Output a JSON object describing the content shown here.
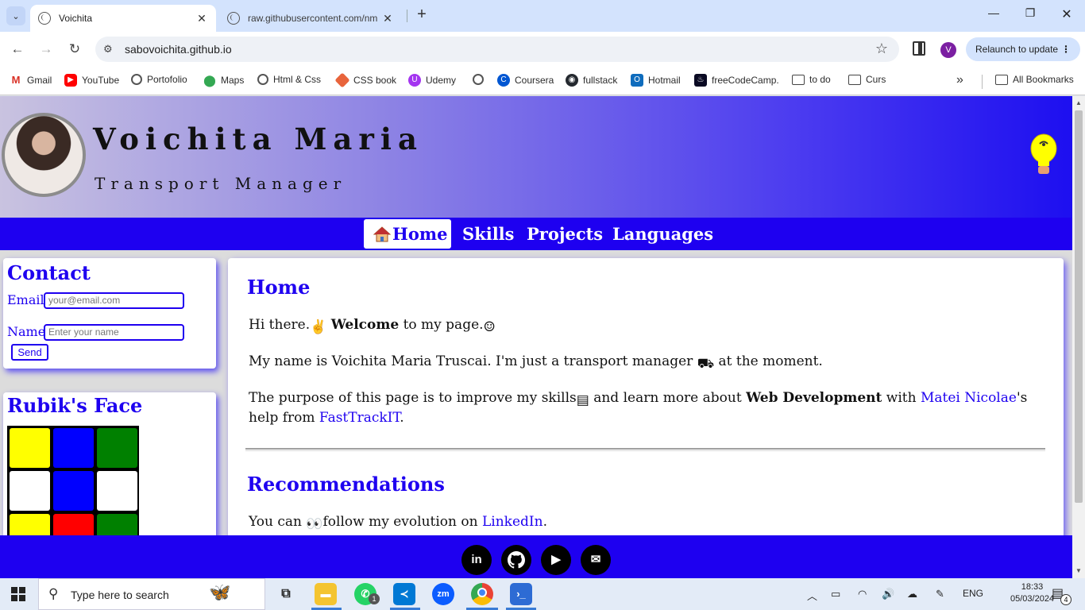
{
  "browser": {
    "tabs": [
      {
        "title": "Voichita",
        "active": true
      },
      {
        "title": "raw.githubusercontent.com/nm",
        "active": false
      }
    ],
    "url": "sabovoichita.github.io",
    "profile_initial": "V",
    "relaunch_label": "Relaunch to update",
    "bookmarks": [
      {
        "label": "Gmail",
        "icon": "gmail-icon"
      },
      {
        "label": "YouTube",
        "icon": "youtube-icon"
      },
      {
        "label": "Portofolio",
        "icon": "globe-icon"
      },
      {
        "label": "Maps",
        "icon": "maps-icon"
      },
      {
        "label": "Html & Css",
        "icon": "globe-icon"
      },
      {
        "label": "CSS book",
        "icon": "css-book-icon"
      },
      {
        "label": "Udemy",
        "icon": "udemy-icon"
      },
      {
        "label": "",
        "icon": "globe-icon"
      },
      {
        "label": "Coursera",
        "icon": "coursera-icon"
      },
      {
        "label": "fullstack",
        "icon": "github-icon"
      },
      {
        "label": "Hotmail",
        "icon": "outlook-icon"
      },
      {
        "label": "freeCodeCamp.",
        "icon": "freecodecamp-icon"
      },
      {
        "label": "to do",
        "icon": "folder-icon"
      },
      {
        "label": "Curs",
        "icon": "folder-icon"
      }
    ],
    "all_bookmarks_label": "All Bookmarks"
  },
  "page": {
    "hero": {
      "name": "Voichita Maria",
      "role": "Transport Manager"
    },
    "nav": {
      "items": [
        {
          "label": "Home",
          "active": true
        },
        {
          "label": "Skills",
          "active": false
        },
        {
          "label": "Projects",
          "active": false
        },
        {
          "label": "Languages",
          "active": false
        }
      ]
    },
    "contact": {
      "title": "Contact",
      "email_label": "Email",
      "email_placeholder": "your@email.com",
      "name_label": "Name",
      "name_placeholder": "Enter your name",
      "send_label": "Send"
    },
    "rubik": {
      "title": "Rubik's Face",
      "cells": [
        "#ffff00",
        "#0000ff",
        "#008000",
        "#ffffff",
        "#0000ff",
        "#ffffff",
        "#ffff00",
        "#ff0000",
        "#008000"
      ]
    },
    "main": {
      "home_title": "Home",
      "greeting_pre": "Hi there.",
      "greeting_bold": "Welcome",
      "greeting_post": "to my page.",
      "intro_pre": "My name is Voichita Maria Truscai. I'm just a transport manager",
      "intro_post": "at the moment.",
      "purpose_pre": "The purpose of this page is to improve my skills",
      "purpose_mid": "and learn more about",
      "purpose_bold": "Web Development",
      "purpose_with": "with",
      "purpose_link1": "Matei Nicolae",
      "purpose_after": "'s help from",
      "purpose_link2": "FastTrackIT",
      "purpose_end": ".",
      "rec_title": "Recommendations",
      "rec_pre": "You can",
      "rec_mid": "follow my evolution on",
      "rec_link": "LinkedIn",
      "rec_end": "."
    },
    "footer": {
      "links": [
        {
          "icon": "linkedin-icon",
          "glyph": "in"
        },
        {
          "icon": "github-icon",
          "glyph": ""
        },
        {
          "icon": "youtube-icon",
          "glyph": "▶"
        },
        {
          "icon": "mail-icon",
          "glyph": "✉"
        }
      ]
    }
  },
  "taskbar": {
    "search_placeholder": "Type here to search",
    "whatsapp_badge": "1",
    "language": "ENG",
    "time": "18:33",
    "date": "05/03/2024",
    "notifications_count": "4"
  },
  "colors": {
    "accent": "#1e00f0",
    "chrome_tabstrip": "#d3e3fd"
  }
}
